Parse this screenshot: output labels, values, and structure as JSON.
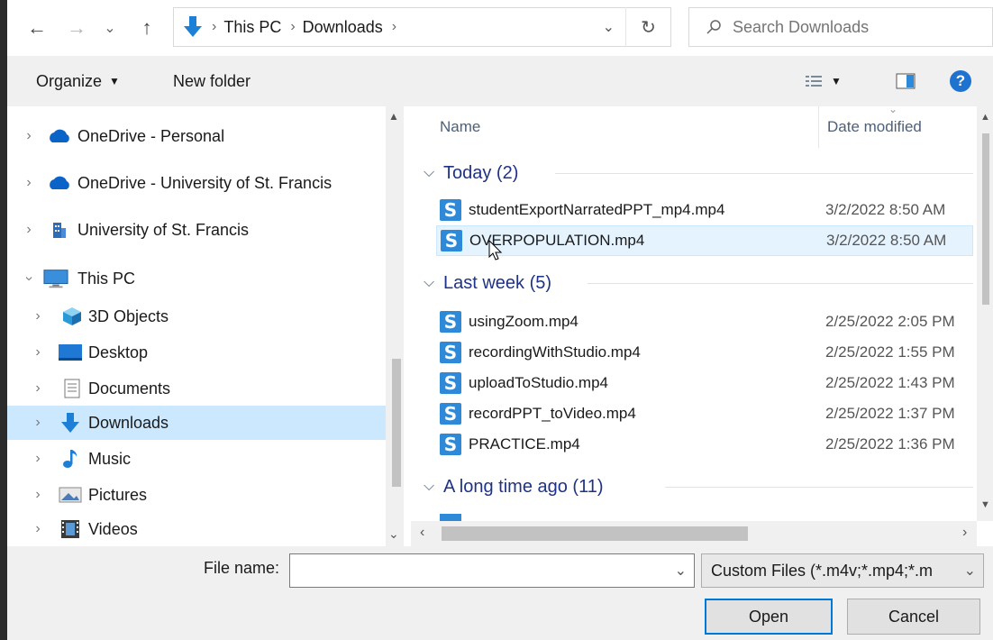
{
  "nav": {
    "back_glyph": "←",
    "forward_glyph": "→",
    "recent_glyph": "⌄",
    "up_glyph": "↑",
    "path": [
      "This PC",
      "Downloads"
    ],
    "refresh_glyph": "↻",
    "search_placeholder": "Search Downloads"
  },
  "toolbar": {
    "organize": "Organize",
    "new_folder": "New folder"
  },
  "sidebar": {
    "items": [
      {
        "label": "OneDrive - Personal",
        "icon": "cloud-icon"
      },
      {
        "label": "OneDrive - University of St. Francis",
        "icon": "cloud-icon"
      },
      {
        "label": "University of St. Francis",
        "icon": "building-icon"
      },
      {
        "label": "This PC",
        "icon": "computer-icon"
      },
      {
        "label": "3D Objects",
        "icon": "cube-icon"
      },
      {
        "label": "Desktop",
        "icon": "desktop-icon"
      },
      {
        "label": "Documents",
        "icon": "document-icon"
      },
      {
        "label": "Downloads",
        "icon": "download-icon"
      },
      {
        "label": "Music",
        "icon": "music-icon"
      },
      {
        "label": "Pictures",
        "icon": "pictures-icon"
      },
      {
        "label": "Videos",
        "icon": "film-icon"
      }
    ]
  },
  "files": {
    "col_name": "Name",
    "col_date": "Date modified",
    "groups": [
      {
        "title": "Today (2)",
        "files": [
          {
            "name": "studentExportNarratedPPT_mp4.mp4",
            "date": "3/2/2022 8:50 AM"
          },
          {
            "name": "OVERPOPULATION.mp4",
            "date": "3/2/2022 8:50 AM"
          }
        ]
      },
      {
        "title": "Last week (5)",
        "files": [
          {
            "name": "usingZoom.mp4",
            "date": "2/25/2022 2:05 PM"
          },
          {
            "name": "recordingWithStudio.mp4",
            "date": "2/25/2022 1:55 PM"
          },
          {
            "name": "uploadToStudio.mp4",
            "date": "2/25/2022 1:43 PM"
          },
          {
            "name": "recordPPT_toVideo.mp4",
            "date": "2/25/2022 1:37 PM"
          },
          {
            "name": "PRACTICE.mp4",
            "date": "2/25/2022 1:36 PM"
          }
        ]
      },
      {
        "title": "A long time ago (11)",
        "files": []
      }
    ]
  },
  "bottom": {
    "file_name_label": "File name:",
    "file_name_value": "",
    "file_type": "Custom Files (*.m4v;*.mp4;*.m",
    "open": "Open",
    "cancel": "Cancel"
  },
  "colors": {
    "selection": "#cce8ff",
    "group_header": "#1e3287",
    "file_icon": "#2e8ad8"
  }
}
